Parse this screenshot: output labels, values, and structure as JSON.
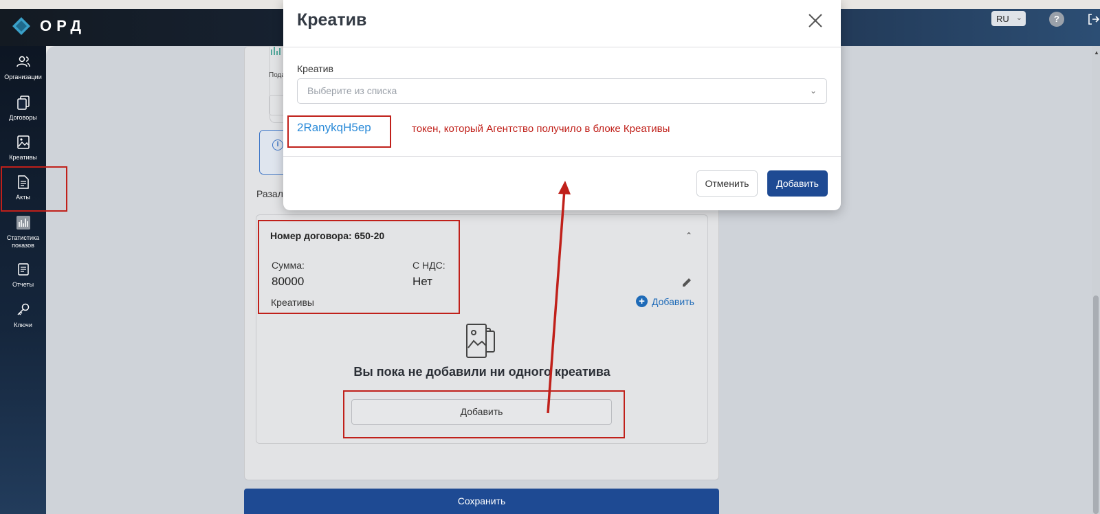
{
  "app": {
    "logo_text": "ОРД"
  },
  "header": {
    "language": "RU",
    "help_symbol": "?"
  },
  "sidebar": {
    "items": [
      {
        "label": "Организации",
        "icon": "users-icon"
      },
      {
        "label": "Договоры",
        "icon": "documents-icon"
      },
      {
        "label": "Креативы",
        "icon": "image-icon"
      },
      {
        "label": "Акты",
        "icon": "document-icon"
      },
      {
        "label": "Статистика показов",
        "icon": "chart-icon"
      },
      {
        "label": "Отчеты",
        "icon": "report-icon"
      },
      {
        "label": "Ключи",
        "icon": "key-icon"
      }
    ]
  },
  "page": {
    "partial_text": "Пода",
    "section_label": "Разал",
    "contract": {
      "title": "Номер договора: 650-20",
      "sum_label": "Сумма:",
      "sum_value": "80000",
      "vat_label": "С НДС:",
      "vat_value": "Нет",
      "creatives_label": "Креативы",
      "add_link": "Добавить",
      "empty_text": "Вы пока не добавили ни одного креатива",
      "empty_add_button": "Добавить"
    },
    "save_button": "Сохранить"
  },
  "modal": {
    "title": "Креатив",
    "field_label": "Креатив",
    "select_placeholder": "Выберите из списка",
    "token": "2RanykqH5ep",
    "cancel_button": "Отменить",
    "add_button": "Добавить"
  },
  "annotations": {
    "note": "токен, который Агентство получило в блоке Креативы",
    "color": "#c0201a"
  },
  "colors": {
    "primary": "#1e4a93",
    "link": "#2a8ad8"
  }
}
